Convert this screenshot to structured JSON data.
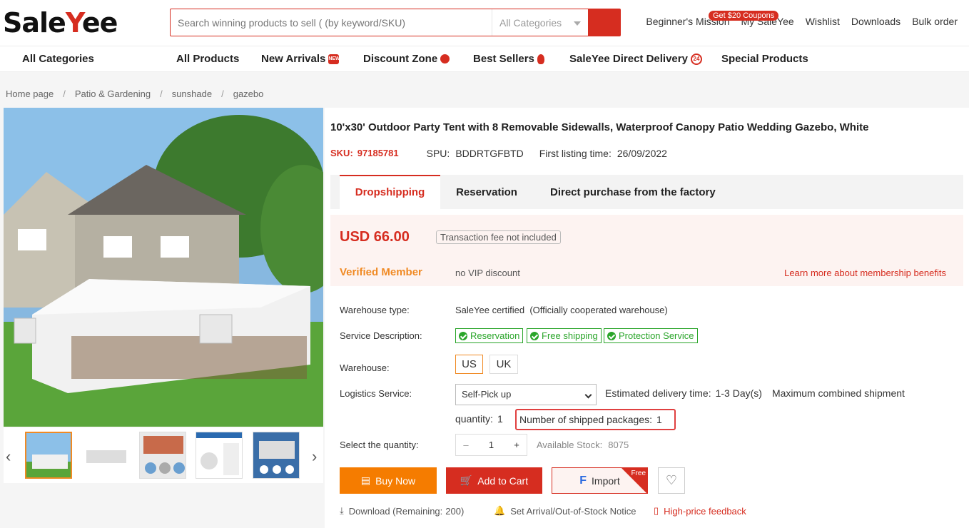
{
  "header": {
    "logo_main": "Sale",
    "logo_y": "Y",
    "logo_end": "ee",
    "search_placeholder": "Search winning products to sell ( (by keyword/SKU)",
    "category_select": "All Categories",
    "coupon": "Get $20 Coupons",
    "links": [
      "Beginner's Mission",
      "My SaleYee",
      "Wishlist",
      "Downloads",
      "Bulk order"
    ]
  },
  "nav": {
    "all_categories": "All Categories",
    "all_products": "All Products",
    "new_arrivals": "New Arrivals",
    "new_badge": "NEW",
    "discount_zone": "Discount Zone",
    "best_sellers": "Best Sellers",
    "direct_delivery": "SaleYee Direct Delivery",
    "direct_badge": "24",
    "special_products": "Special Products"
  },
  "breadcrumb": [
    "Home page",
    "Patio & Gardening",
    "sunshade",
    "gazebo"
  ],
  "product": {
    "title": "10'x30' Outdoor Party Tent with 8 Removable Sidewalls, Waterproof Canopy Patio Wedding Gazebo, White",
    "sku_label": "SKU:",
    "sku": "97185781",
    "spu_label": "SPU:",
    "spu": "BDDRTGFBTD",
    "listing_label": "First listing time:",
    "listing_time": "26/09/2022"
  },
  "tabs": [
    "Dropshipping",
    "Reservation",
    "Direct purchase from the factory"
  ],
  "price": {
    "amount": "USD 66.00",
    "fee_note": "Transaction fee not included",
    "member": "Verified Member",
    "vip": "no VIP discount",
    "learn_more": "Learn more about membership benefits"
  },
  "details": {
    "warehouse_type_label": "Warehouse type:",
    "warehouse_type": "SaleYee certified",
    "warehouse_note": "(Officially cooperated warehouse)",
    "service_label": "Service Description:",
    "services": [
      "Reservation",
      "Free shipping",
      "Protection Service"
    ],
    "warehouse_label": "Warehouse:",
    "warehouses": [
      "US",
      "UK"
    ],
    "logistics_label": "Logistics Service:",
    "logistics_value": "Self-Pick up",
    "delivery_text": "Estimated delivery time:",
    "delivery_value": "1-3 Day(s)",
    "max_shipment": "Maximum combined shipment",
    "quantity_text": "quantity:",
    "quantity_value": "1",
    "packages_text": "Number of shipped packages:",
    "packages_value": "1",
    "select_qty_label": "Select the quantity:",
    "qty_minus": "–",
    "qty_value": "1",
    "qty_plus": "+",
    "stock_label": "Available Stock:",
    "stock_value": "8075"
  },
  "actions": {
    "buy_now": "Buy Now",
    "add_to_cart": "Add to Cart",
    "import": "Import",
    "free": "Free",
    "download": "Download (Remaining:",
    "download_count": "200)",
    "notice": "Set Arrival/Out-of-Stock Notice",
    "feedback": "High-price feedback"
  },
  "colors": {
    "brand": "#d62d20",
    "orange": "#f57c00",
    "green": "#2aa52a"
  }
}
